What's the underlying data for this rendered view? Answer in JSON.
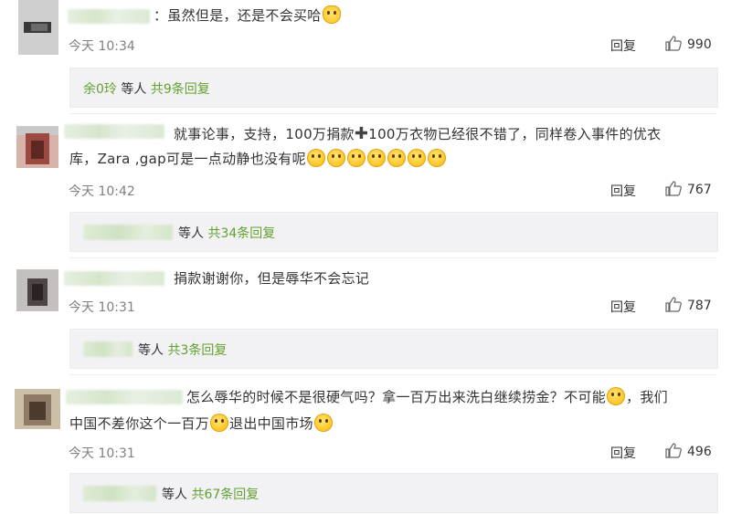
{
  "comments": [
    {
      "text": "：虽然但是，还是不会买哈",
      "time": "今天 10:34",
      "reply_label": "回复",
      "likes": "990",
      "reply_prefix": "余0玲",
      "reply_others": " 等人 ",
      "reply_count": "共9条回复"
    },
    {
      "text_a": "就事论事，支持，100万捐款",
      "text_b": "100万衣物已经很不错了，同样卷入事件的优衣",
      "text_c": "库，Zara ,gap可是一点动静也没有呢",
      "time": "今天 10:42",
      "reply_label": "回复",
      "likes": "767",
      "reply_others": "等人 ",
      "reply_count": "共34条回复"
    },
    {
      "text": "捐款谢谢你，但是辱华不会忘记",
      "time": "今天 10:31",
      "reply_label": "回复",
      "likes": "787",
      "reply_others": "等人 ",
      "reply_count": "共3条回复"
    },
    {
      "text_a": "怎么辱华的时候不是很硬气吗？拿一百万出来洗白继续捞金？不可能",
      "text_b": "，我们",
      "text_c": "中国不差你这个一百万",
      "text_d": "退出中国市场",
      "time": "今天 10:31",
      "reply_label": "回复",
      "likes": "496",
      "reply_others": "等人 ",
      "reply_count": "共67条回复"
    }
  ],
  "icons": {
    "like": "thumbs-up-icon",
    "emoji": "smiley-emoji-icon",
    "plus": "plus-icon"
  },
  "colors": {
    "accent_green": "#63a12f",
    "time_gray": "#808080",
    "reply_box_bg": "#f2f2f5"
  }
}
